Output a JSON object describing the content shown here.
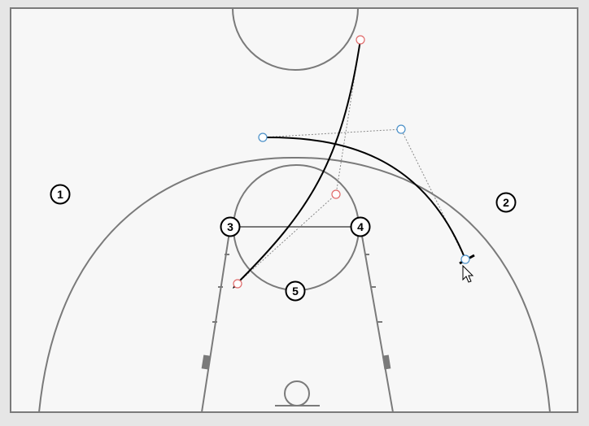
{
  "colors": {
    "background": "#e6e6e6",
    "court": "#f7f7f7",
    "court_lines": "#7a7a7a",
    "path": "#000000",
    "guide": "#8a8a8a",
    "handle_red": "#e06a6a",
    "handle_blue": "#4a90c8"
  },
  "players": [
    {
      "label": "1"
    },
    {
      "label": "2"
    },
    {
      "label": "3"
    },
    {
      "label": "4"
    },
    {
      "label": "5"
    }
  ],
  "icons": {
    "cursor": "mouse-pointer-icon"
  }
}
